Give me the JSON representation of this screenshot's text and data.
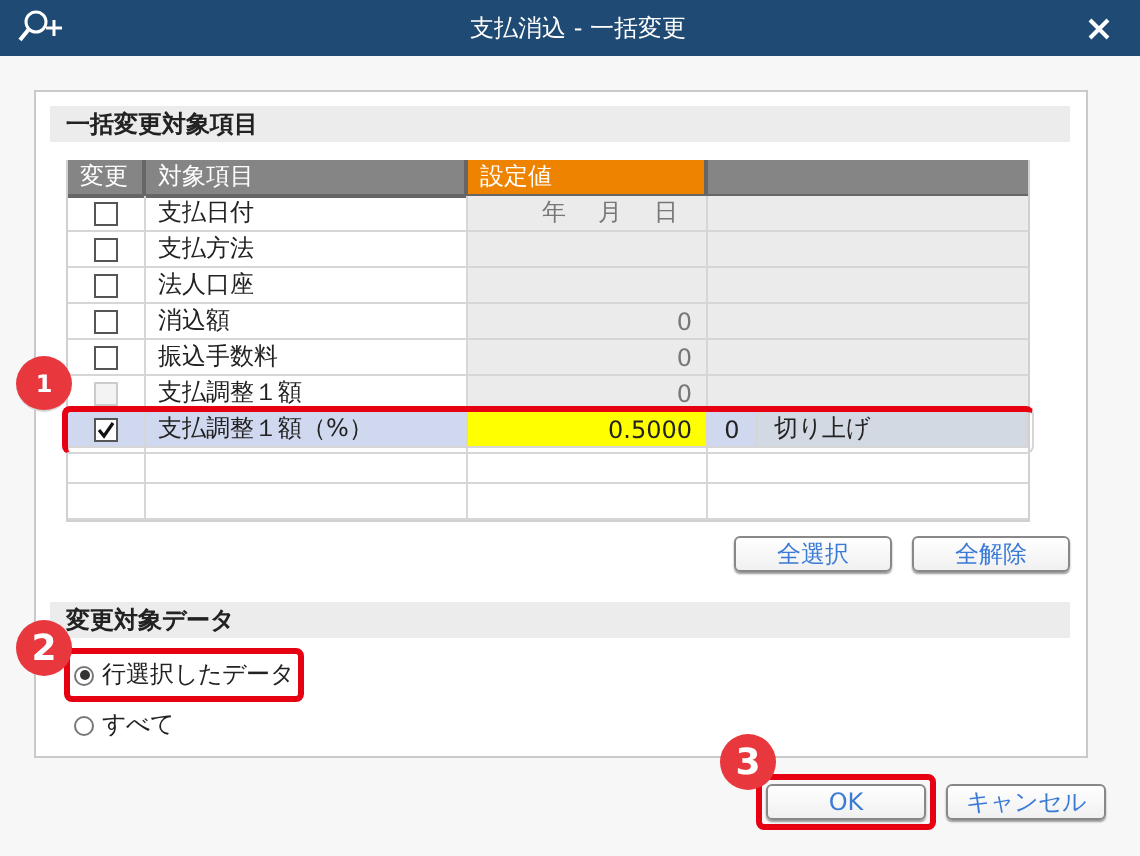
{
  "window": {
    "title": "支払消込 - 一括変更"
  },
  "items_section": {
    "title": "一括変更対象項目",
    "columns": [
      {
        "label": "変更",
        "highlighted": false
      },
      {
        "label": "対象項目",
        "highlighted": false
      },
      {
        "label": "設定値",
        "highlighted": true
      }
    ],
    "rows": [
      {
        "kind": "date",
        "label": "支払日付",
        "checked": false,
        "disabled": false,
        "selected": false,
        "date_parts": [
          "年",
          "月",
          "日"
        ]
      },
      {
        "kind": "blank",
        "label": "支払方法",
        "checked": false,
        "disabled": false,
        "selected": false
      },
      {
        "kind": "blank",
        "label": "法人口座",
        "checked": false,
        "disabled": false,
        "selected": false
      },
      {
        "kind": "amount",
        "label": "消込額",
        "checked": false,
        "disabled": false,
        "selected": false,
        "value": "0"
      },
      {
        "kind": "amount",
        "label": "振込手数料",
        "checked": false,
        "disabled": false,
        "selected": false,
        "value": "0"
      },
      {
        "kind": "amount",
        "label": "支払調整１額",
        "checked": false,
        "disabled": true,
        "selected": false,
        "value": "0"
      },
      {
        "kind": "rate",
        "label": "支払調整１額（%）",
        "checked": true,
        "disabled": false,
        "selected": true,
        "value": "0.5000",
        "digits": "0",
        "rounding": "切り上げ",
        "callout": "1"
      }
    ],
    "buttons": [
      "全選択",
      "全解除"
    ]
  },
  "target_section": {
    "title": "変更対象データ",
    "options": [
      {
        "label": "行選択したデータ",
        "selected": true,
        "callout": "2"
      },
      {
        "label": "すべて",
        "selected": false
      }
    ]
  },
  "footer_buttons": [
    {
      "label": "OK",
      "callout": "3"
    },
    {
      "label": "キャンセル"
    }
  ]
}
